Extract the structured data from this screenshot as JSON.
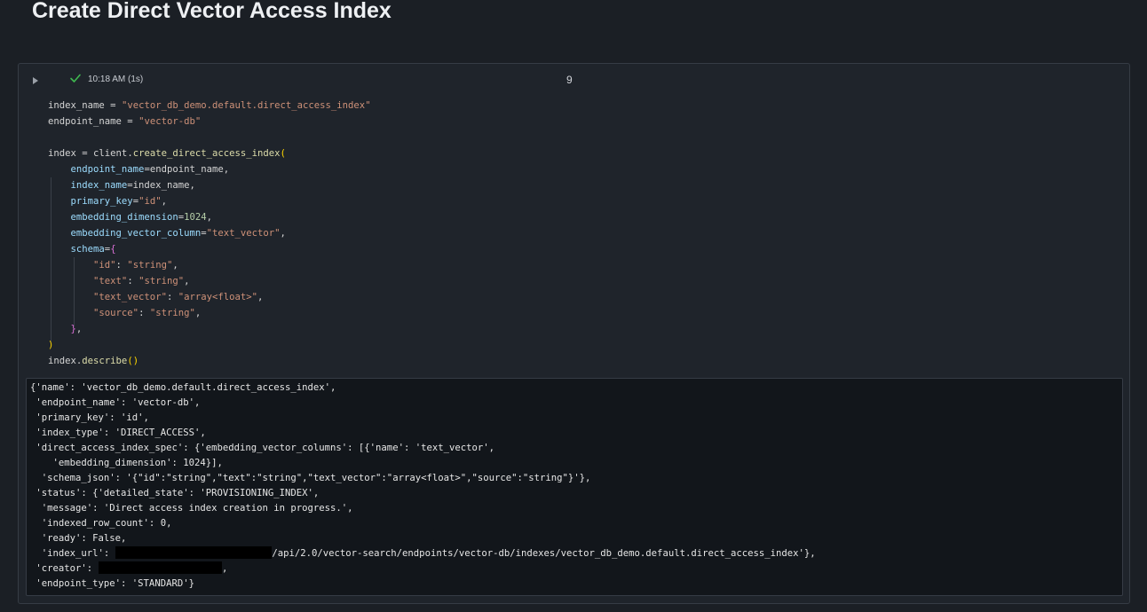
{
  "page": {
    "heading": "Create Direct Vector Access Index"
  },
  "cell": {
    "status_icon": "check-icon",
    "run_time": "10:18 AM (1s)",
    "number": "9",
    "colors": {
      "string": "#ce9178",
      "function": "#dcdcaa",
      "keyword_arg": "#9cdcfe",
      "number": "#b5cea8",
      "success": "#3fb950"
    }
  },
  "code": {
    "lines": [
      [
        {
          "t": "index_name ",
          "c": "var"
        },
        {
          "t": "= ",
          "c": "op"
        },
        {
          "t": "\"vector_db_demo.default.direct_access_index\"",
          "c": "str"
        }
      ],
      [
        {
          "t": "endpoint_name ",
          "c": "var"
        },
        {
          "t": "= ",
          "c": "op"
        },
        {
          "t": "\"vector-db\"",
          "c": "str"
        }
      ],
      [],
      [
        {
          "t": "index ",
          "c": "var"
        },
        {
          "t": "= ",
          "c": "op"
        },
        {
          "t": "client.",
          "c": "var"
        },
        {
          "t": "create_direct_access_index",
          "c": "fn"
        },
        {
          "t": "(",
          "c": "br1"
        }
      ],
      [
        {
          "t": "    ",
          "c": "var"
        },
        {
          "t": "endpoint_name",
          "c": "kw"
        },
        {
          "t": "=endpoint_name,",
          "c": "var"
        }
      ],
      [
        {
          "t": "    ",
          "c": "var"
        },
        {
          "t": "index_name",
          "c": "kw"
        },
        {
          "t": "=index_name,",
          "c": "var"
        }
      ],
      [
        {
          "t": "    ",
          "c": "var"
        },
        {
          "t": "primary_key",
          "c": "kw"
        },
        {
          "t": "=",
          "c": "op"
        },
        {
          "t": "\"id\"",
          "c": "str"
        },
        {
          "t": ",",
          "c": "var"
        }
      ],
      [
        {
          "t": "    ",
          "c": "var"
        },
        {
          "t": "embedding_dimension",
          "c": "kw"
        },
        {
          "t": "=",
          "c": "op"
        },
        {
          "t": "1024",
          "c": "num"
        },
        {
          "t": ",",
          "c": "var"
        }
      ],
      [
        {
          "t": "    ",
          "c": "var"
        },
        {
          "t": "embedding_vector_column",
          "c": "kw"
        },
        {
          "t": "=",
          "c": "op"
        },
        {
          "t": "\"text_vector\"",
          "c": "str"
        },
        {
          "t": ",",
          "c": "var"
        }
      ],
      [
        {
          "t": "    ",
          "c": "var"
        },
        {
          "t": "schema",
          "c": "kw"
        },
        {
          "t": "=",
          "c": "op"
        },
        {
          "t": "{",
          "c": "br2"
        }
      ],
      [
        {
          "t": "        ",
          "c": "var"
        },
        {
          "t": "\"id\"",
          "c": "str"
        },
        {
          "t": ": ",
          "c": "var"
        },
        {
          "t": "\"string\"",
          "c": "str"
        },
        {
          "t": ",",
          "c": "var"
        }
      ],
      [
        {
          "t": "        ",
          "c": "var"
        },
        {
          "t": "\"text\"",
          "c": "str"
        },
        {
          "t": ": ",
          "c": "var"
        },
        {
          "t": "\"string\"",
          "c": "str"
        },
        {
          "t": ",",
          "c": "var"
        }
      ],
      [
        {
          "t": "        ",
          "c": "var"
        },
        {
          "t": "\"text_vector\"",
          "c": "str"
        },
        {
          "t": ": ",
          "c": "var"
        },
        {
          "t": "\"array<float>\"",
          "c": "str"
        },
        {
          "t": ",",
          "c": "var"
        }
      ],
      [
        {
          "t": "        ",
          "c": "var"
        },
        {
          "t": "\"source\"",
          "c": "str"
        },
        {
          "t": ": ",
          "c": "var"
        },
        {
          "t": "\"string\"",
          "c": "str"
        },
        {
          "t": ",",
          "c": "var"
        }
      ],
      [
        {
          "t": "    ",
          "c": "var"
        },
        {
          "t": "}",
          "c": "br2"
        },
        {
          "t": ",",
          "c": "var"
        }
      ],
      [
        {
          "t": ")",
          "c": "br1"
        }
      ],
      [
        {
          "t": "index.",
          "c": "var"
        },
        {
          "t": "describe",
          "c": "fn"
        },
        {
          "t": "()",
          "c": "br1"
        }
      ]
    ]
  },
  "output": {
    "lines": [
      [
        "{'name': 'vector_db_demo.default.direct_access_index',"
      ],
      [
        " 'endpoint_name': 'vector-db',"
      ],
      [
        " 'primary_key': 'id',"
      ],
      [
        " 'index_type': 'DIRECT_ACCESS',"
      ],
      [
        " 'direct_access_index_spec': {'embedding_vector_columns': [{'name': 'text_vector',"
      ],
      [
        "    'embedding_dimension': 1024}],"
      ],
      [
        "  'schema_json': '{\"id\":\"string\",\"text\":\"string\",\"text_vector\":\"array<float>\",\"source\":\"string\"}'},"
      ],
      [
        " 'status': {'detailed_state': 'PROVISIONING_INDEX',"
      ],
      [
        "  'message': 'Direct access index creation in progress.',"
      ],
      [
        "  'indexed_row_count': 0,"
      ],
      [
        "  'ready': False,"
      ],
      [
        "  'index_url': ",
        {
          "redacted": 38
        },
        "/api/2.0/vector-search/endpoints/vector-db/indexes/vector_db_demo.default.direct_access_index'},"
      ],
      [
        " 'creator': ",
        {
          "redacted": 30
        },
        ","
      ],
      [
        " 'endpoint_type': 'STANDARD'}"
      ]
    ]
  }
}
